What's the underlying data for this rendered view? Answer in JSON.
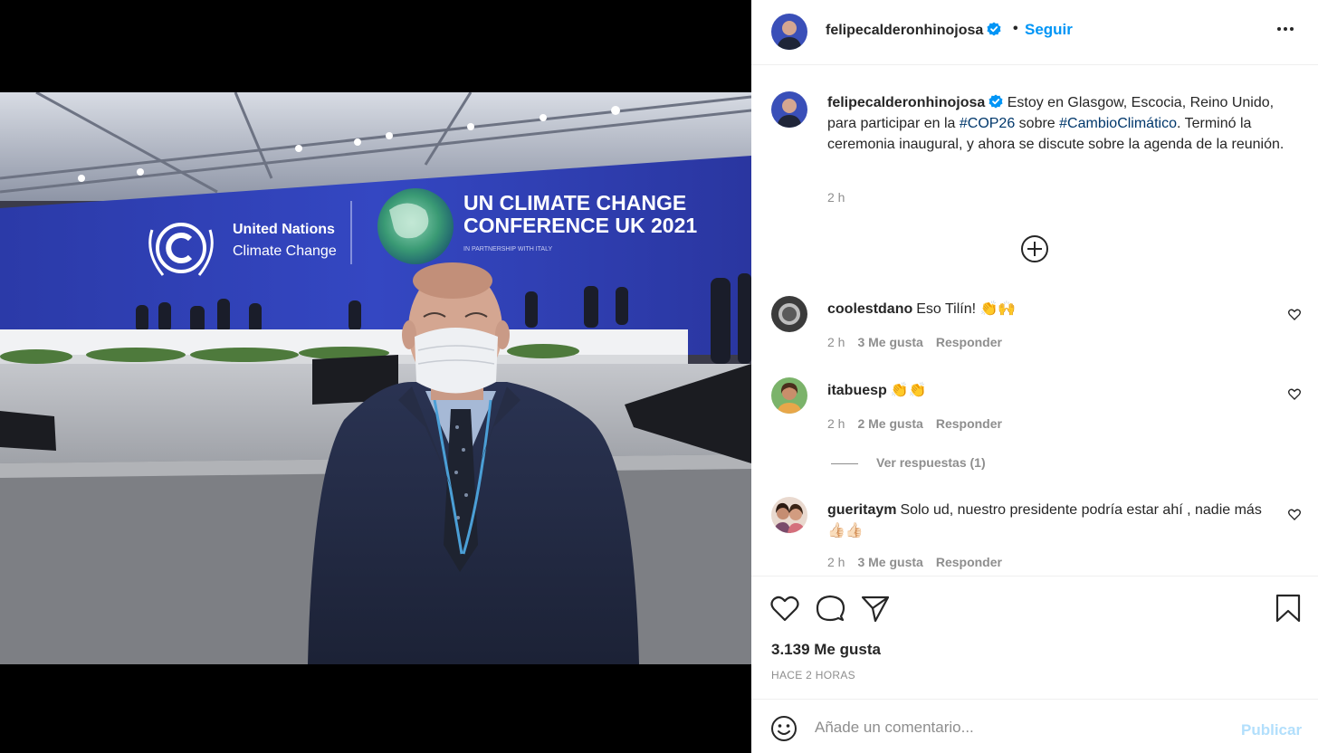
{
  "post": {
    "username": "felipecalderonhinojosa",
    "follow_label": "Seguir",
    "separator": "•",
    "caption": {
      "text_before": "Estoy en Glasgow, Escocia, Reino Unido, para participar en la ",
      "tag1": "#COP26",
      "text_mid": " sobre ",
      "tag2": "#CambioClimático",
      "text_after": ". Terminó la ceremonia inaugural, y ahora se discute sobre la agenda de la reunión.",
      "time": "2 h"
    },
    "comments": [
      {
        "user": "coolestdano",
        "text": "Eso Tilín! 👏🙌",
        "time": "2 h",
        "likes": "3 Me gusta",
        "reply": "Responder"
      },
      {
        "user": "itabuesp",
        "text": "👏👏",
        "time": "2 h",
        "likes": "2 Me gusta",
        "reply": "Responder"
      },
      {
        "user": "gueritaym",
        "text": "Solo ud, nuestro presidente podría estar ahí , nadie más 👍🏻👍🏻",
        "time": "2 h",
        "likes": "3 Me gusta",
        "reply": "Responder"
      }
    ],
    "view_replies": "Ver respuestas (1)",
    "likes_count": "3.139 Me gusta",
    "posted_time": "HACE 2 HORAS",
    "comment_placeholder": "Añade un comentario...",
    "publish_label": "Publicar"
  },
  "photo": {
    "banner_left_line1": "United Nations",
    "banner_left_line2": "Climate Change",
    "banner_right_line1": "UN CLIMATE CHANGE",
    "banner_right_line2": "CONFERENCE UK 2021",
    "banner_right_line3": "IN PARTNERSHIP WITH ITALY"
  },
  "colors": {
    "link": "#0095f6",
    "hashtag": "#00376b",
    "muted": "#8e8e8e",
    "banner_blue": "#2f3fb4"
  },
  "icons": [
    "verified-badge-icon",
    "more-options-icon",
    "load-more-icon",
    "heart-icon",
    "comment-icon",
    "share-icon",
    "bookmark-icon",
    "emoji-icon"
  ]
}
